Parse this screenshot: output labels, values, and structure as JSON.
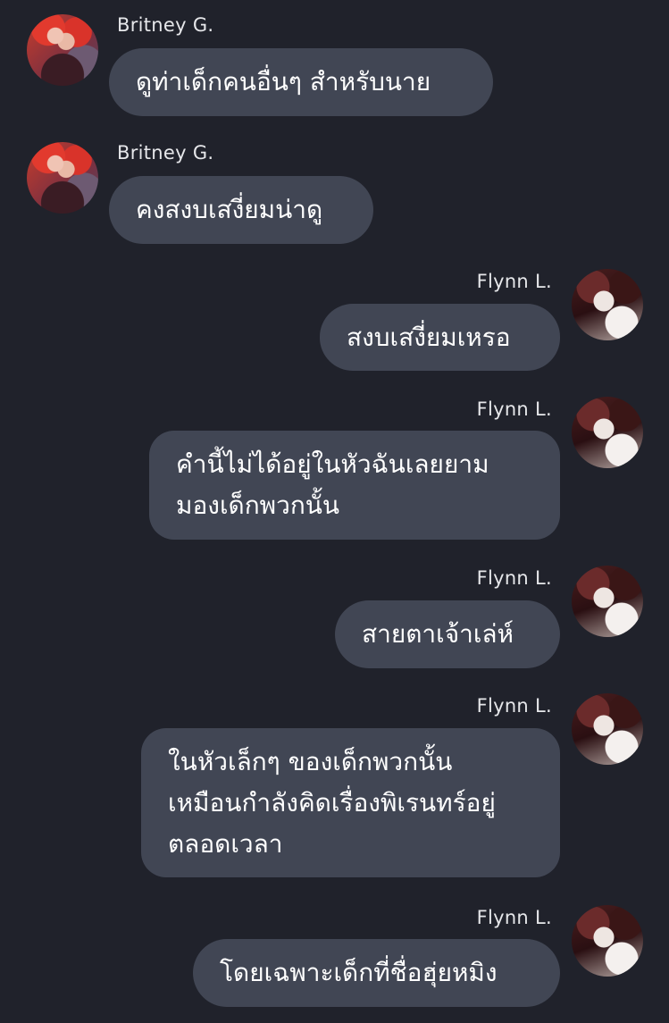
{
  "messages": [
    {
      "sender": "Britney G.",
      "side": "left",
      "text": "ดูท่าเด็กคนอื่นๆ สำหรับนาย"
    },
    {
      "sender": "Britney G.",
      "side": "left",
      "text": "คงสงบเสงี่ยมน่าดู"
    },
    {
      "sender": "Flynn L.",
      "side": "right",
      "text": "สงบเสงี่ยมเหรอ"
    },
    {
      "sender": "Flynn L.",
      "side": "right",
      "text": "คำนี้ไม่ได้อยู่ในหัวฉันเลยยาม\nมองเด็กพวกนั้น"
    },
    {
      "sender": "Flynn L.",
      "side": "right",
      "text": "สายตาเจ้าเล่ห์"
    },
    {
      "sender": "Flynn L.",
      "side": "right",
      "text": "ในหัวเล็กๆ ของเด็กพวกนั้น\nเหมือนกำลังคิดเรื่องพิเรนทร์อยู่\nตลอดเวลา"
    },
    {
      "sender": "Flynn L.",
      "side": "right",
      "text": "โดยเฉพาะเด็กที่ชื่อฮุ่ยหมิง"
    }
  ]
}
